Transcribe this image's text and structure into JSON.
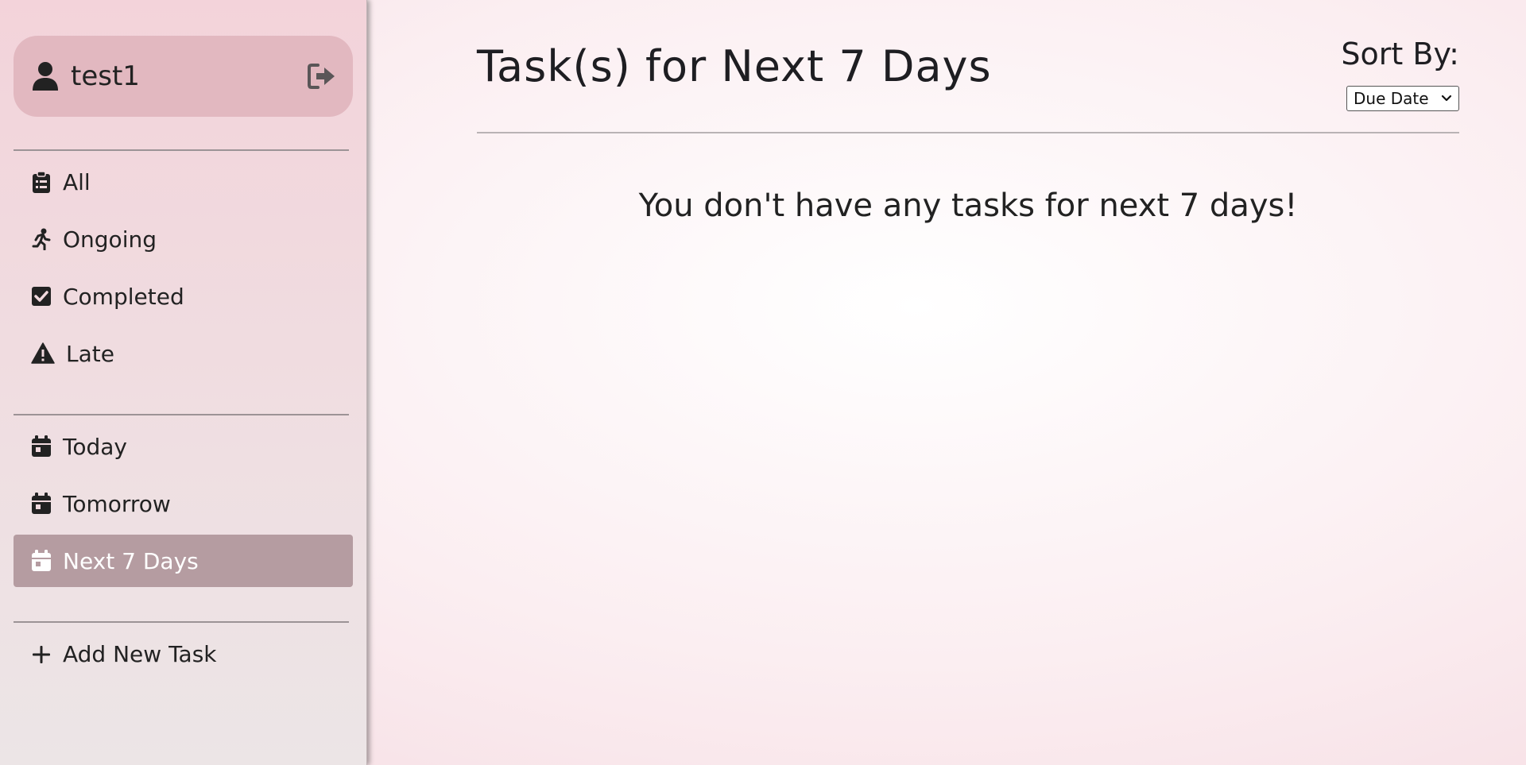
{
  "user": {
    "name": "test1"
  },
  "nav": {
    "status_items": [
      {
        "label": "All",
        "icon": "clipboard-icon"
      },
      {
        "label": "Ongoing",
        "icon": "running-person-icon"
      },
      {
        "label": "Completed",
        "icon": "checkbox-icon"
      },
      {
        "label": "Late",
        "icon": "warning-icon"
      }
    ],
    "date_items": [
      {
        "label": "Today",
        "icon": "calendar-icon"
      },
      {
        "label": "Tomorrow",
        "icon": "calendar-icon"
      },
      {
        "label": "Next 7 Days",
        "icon": "calendar-icon",
        "active": true
      }
    ],
    "add_task_label": "Add New Task"
  },
  "main": {
    "title": "Task(s) for Next 7 Days",
    "sort_label": "Sort By:",
    "sort_value": "Due Date",
    "empty_message": "You don't have any tasks for next 7 days!"
  },
  "colors": {
    "sidebar_active_bg": "#b59ca1",
    "user_card_bg": "#e2b8c0"
  }
}
